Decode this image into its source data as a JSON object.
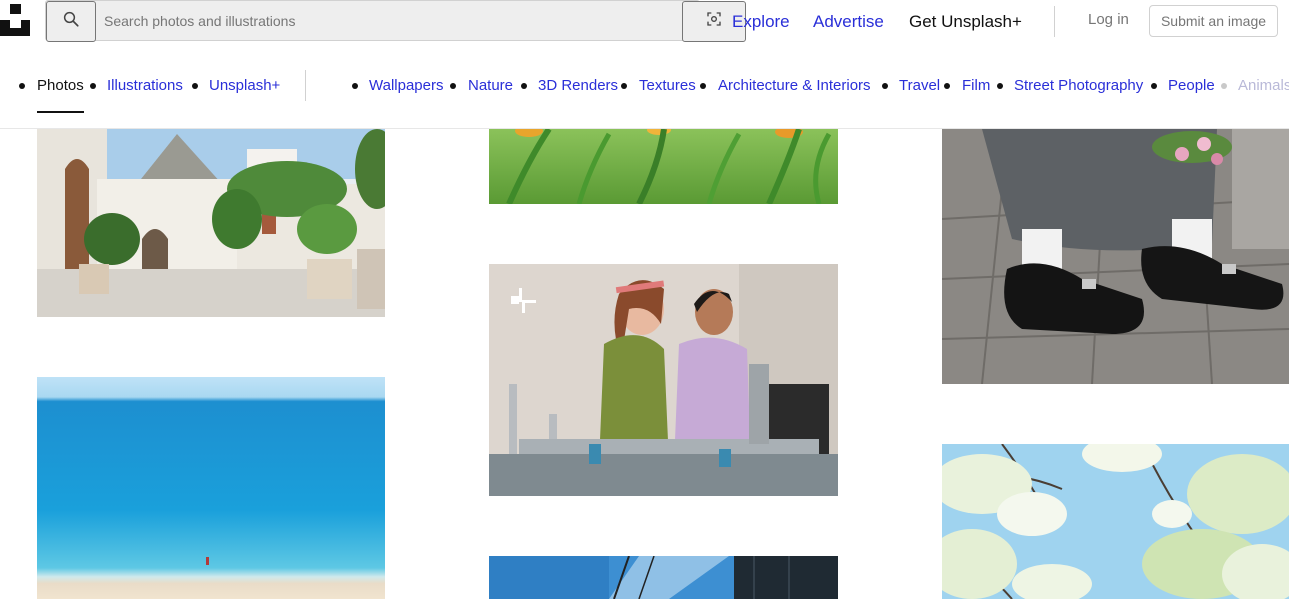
{
  "header": {
    "search": {
      "placeholder": "Search photos and illustrations",
      "icon": "search-icon",
      "visual_search_icon": "visual-search-icon"
    },
    "nav": [
      {
        "label": "Explore"
      },
      {
        "label": "Advertise"
      },
      {
        "label": "Get Unsplash+"
      }
    ],
    "login_label": "Log in",
    "submit_label": "Submit an image"
  },
  "categories": {
    "primary": [
      {
        "label": "Photos",
        "active": true
      },
      {
        "label": "Illustrations"
      },
      {
        "label": "Unsplash+"
      }
    ],
    "topics": [
      {
        "label": "Wallpapers"
      },
      {
        "label": "Nature"
      },
      {
        "label": "3D Renders"
      },
      {
        "label": "Textures"
      },
      {
        "label": "Architecture & Interiors"
      },
      {
        "label": "Travel"
      },
      {
        "label": "Film"
      },
      {
        "label": "Street Photography"
      },
      {
        "label": "People"
      },
      {
        "label": "Animals"
      }
    ]
  },
  "colors": {
    "link_blue": "#2a2fd8",
    "text_dark": "#111111",
    "muted": "#767676"
  },
  "photos": [
    {
      "subject": "whitewashed trulli houses courtyard"
    },
    {
      "subject": "turquoise sea and sandy beach"
    },
    {
      "subject": "green tulip field"
    },
    {
      "subject": "two students in a lab with machinery",
      "badge_icon": "unsplash-plus-icon"
    },
    {
      "subject": "blue sky with building"
    },
    {
      "subject": "person in grey coat and black loafers holding flowers"
    },
    {
      "subject": "white blossom tree against blue sky"
    }
  ]
}
